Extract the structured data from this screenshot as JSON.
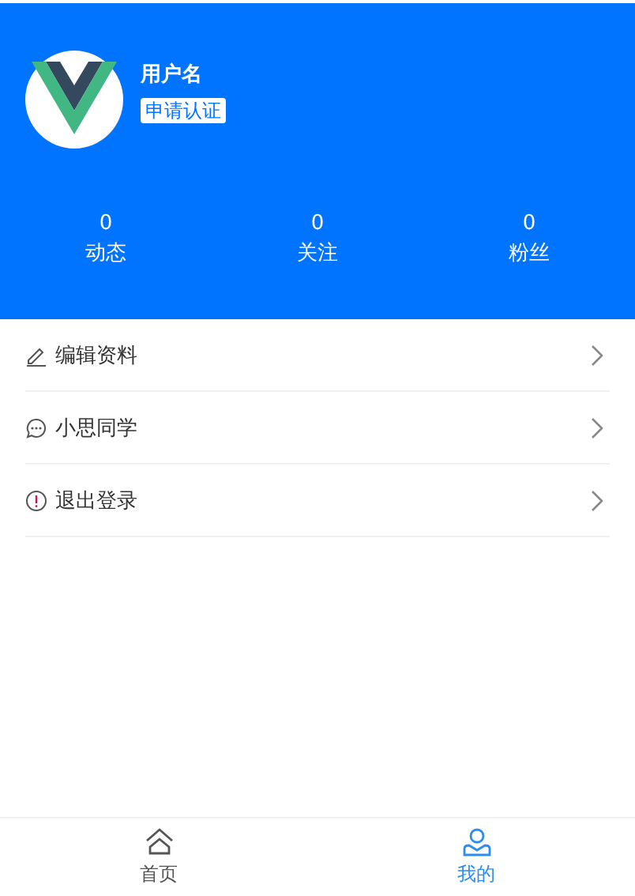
{
  "profile": {
    "username": "用户名",
    "badge": "申请认证"
  },
  "stats": [
    {
      "count": "0",
      "label": "动态"
    },
    {
      "count": "0",
      "label": "关注"
    },
    {
      "count": "0",
      "label": "粉丝"
    }
  ],
  "menu": [
    {
      "kind": "edit",
      "label": "编辑资料"
    },
    {
      "kind": "chat",
      "label": "小思同学"
    },
    {
      "kind": "alert",
      "label": "退出登录"
    }
  ],
  "tabbar": [
    {
      "kind": "home",
      "label": "首页",
      "selected": false
    },
    {
      "kind": "user",
      "label": "我的",
      "selected": true
    }
  ]
}
